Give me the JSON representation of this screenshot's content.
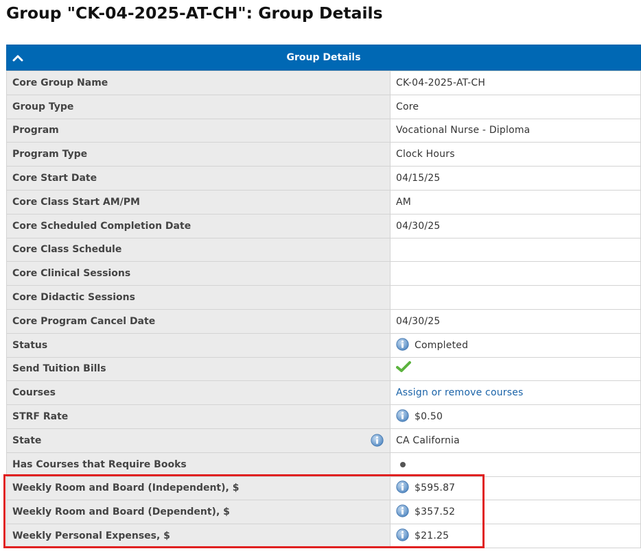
{
  "page_title": "Group \"CK-04-2025-AT-CH\": Group Details",
  "panel": {
    "title": "Group Details",
    "rows": [
      {
        "label": "Core Group Name",
        "value": "CK-04-2025-AT-CH"
      },
      {
        "label": "Group Type",
        "value": "Core"
      },
      {
        "label": "Program",
        "value": "Vocational Nurse - Diploma"
      },
      {
        "label": "Program Type",
        "value": "Clock Hours"
      },
      {
        "label": "Core Start Date",
        "value": "04/15/25"
      },
      {
        "label": "Core Class Start AM/PM",
        "value": "AM"
      },
      {
        "label": "Core Scheduled Completion Date",
        "value": "04/30/25"
      },
      {
        "label": "Core Class Schedule",
        "value": ""
      },
      {
        "label": "Core Clinical Sessions",
        "value": ""
      },
      {
        "label": "Core Didactic Sessions",
        "value": ""
      },
      {
        "label": "Core Program Cancel Date",
        "value": "04/30/25"
      },
      {
        "label": "Status",
        "value": "Completed"
      },
      {
        "label": "Send Tuition Bills",
        "value": "checked"
      },
      {
        "label": "Courses",
        "value": "Assign or remove courses"
      },
      {
        "label": "STRF Rate",
        "value": "$0.50"
      },
      {
        "label": "State",
        "value": "CA California"
      },
      {
        "label": "Has Courses that Require Books",
        "value": "dot"
      },
      {
        "label": "Weekly Room and Board (Independent), $",
        "value": "$595.87"
      },
      {
        "label": "Weekly Room and Board (Dependent), $",
        "value": "$357.52"
      },
      {
        "label": "Weekly Personal Expenses, $",
        "value": "$21.25"
      }
    ]
  },
  "colors": {
    "header_bg": "#0068b4",
    "label_bg": "#ebebeb",
    "link": "#1a63a8",
    "highlight": "#e02020",
    "check": "#5cb33e"
  },
  "icons": {
    "collapse": "chevron-up-icon",
    "info": "info-icon",
    "check": "checkmark-icon",
    "bullet": "dot-icon"
  }
}
